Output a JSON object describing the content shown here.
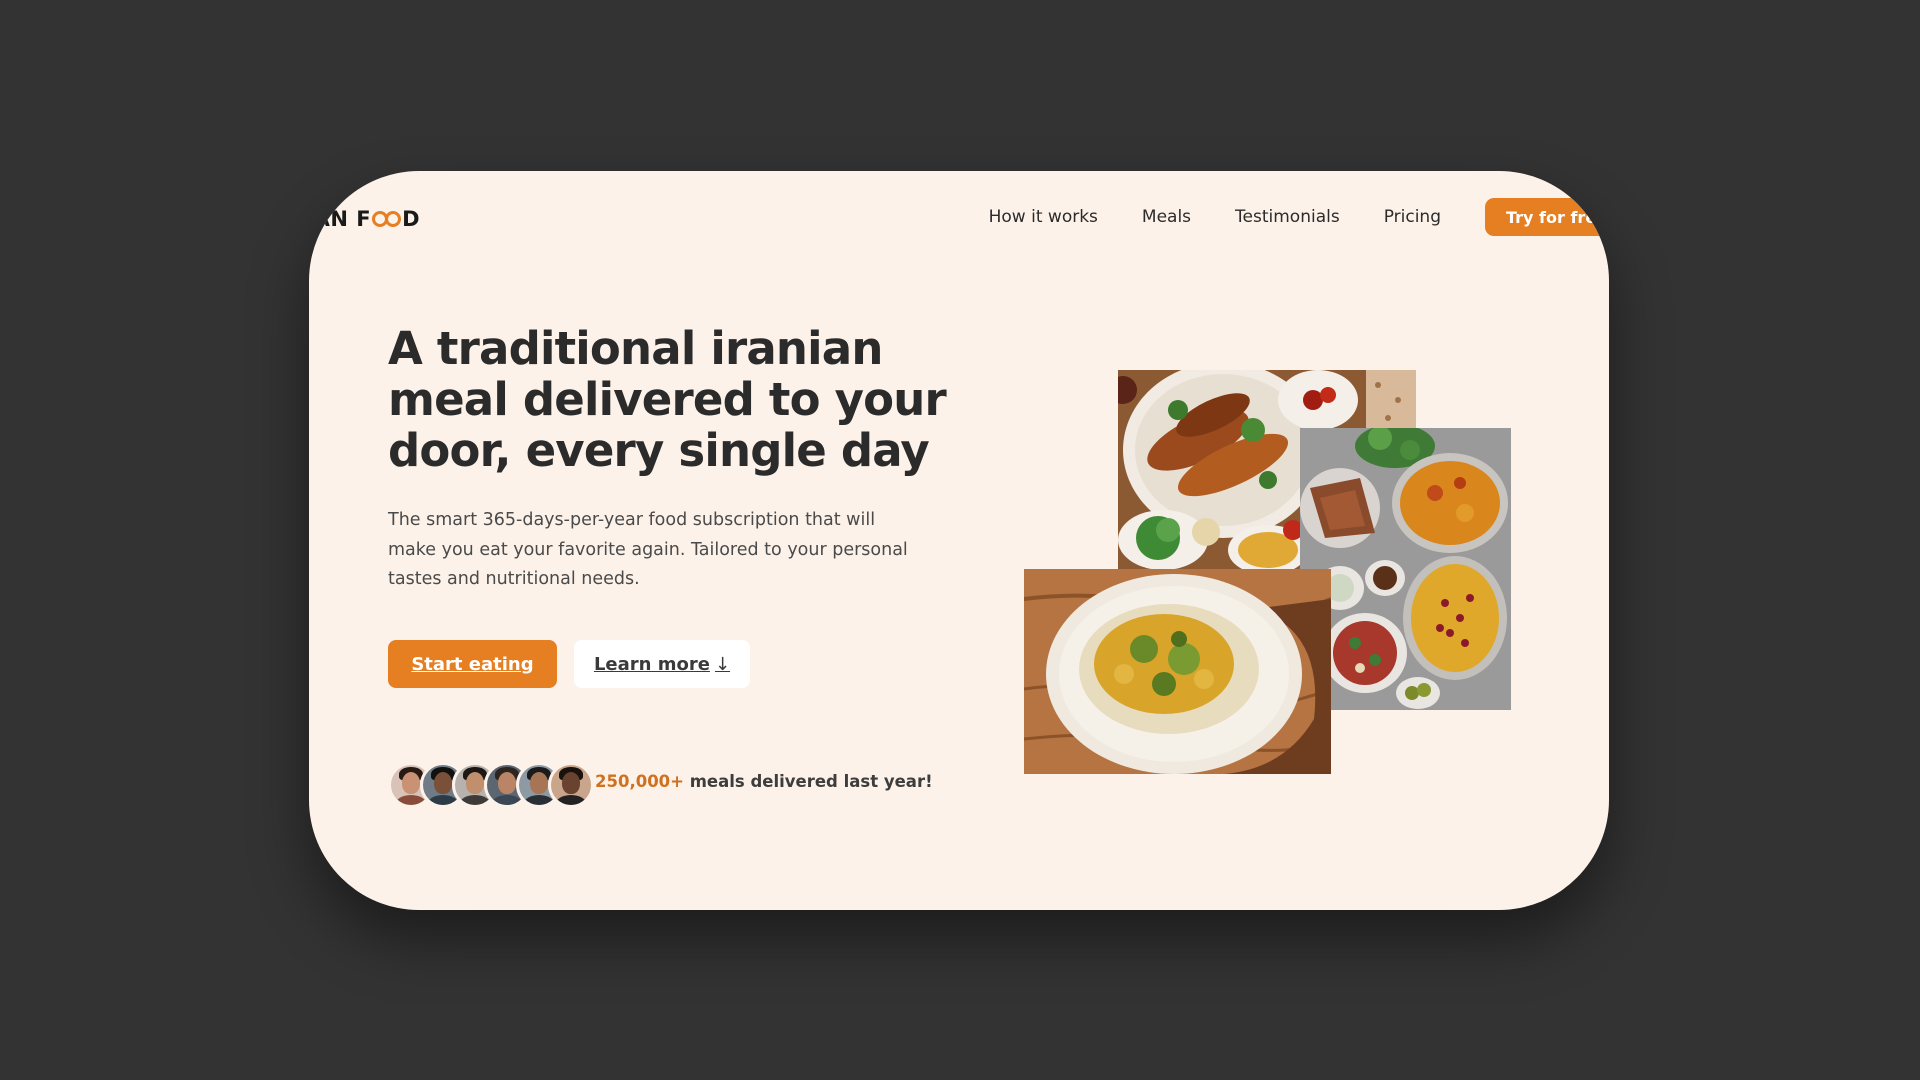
{
  "brand": {
    "logo_text": "IRAN FOOD",
    "logo_prefix": "RAN F",
    "logo_suffix": "D",
    "accent_color": "#e67e22"
  },
  "nav": {
    "items": [
      {
        "label": "How it works"
      },
      {
        "label": "Meals"
      },
      {
        "label": "Testimonials"
      },
      {
        "label": "Pricing"
      }
    ],
    "cta_label": "Try for free"
  },
  "hero": {
    "title": "A traditional iranian meal delivered to your door, every single day",
    "description": "The smart 365-days-per-year food subscription that will make you eat your favorite again. Tailored to your personal tastes and nutritional needs.",
    "primary_button": "Start eating",
    "secondary_button": "Learn more",
    "secondary_button_icon": "arrow-down-icon",
    "secondary_button_glyph": "↓"
  },
  "social_proof": {
    "count": "250,000+",
    "text": "meals delivered last year!",
    "avatar_count": 6
  },
  "colors": {
    "page_background": "#333333",
    "card_background": "#fdf2e9",
    "primary": "#e67e22",
    "text_dark": "#2b2b2b"
  }
}
